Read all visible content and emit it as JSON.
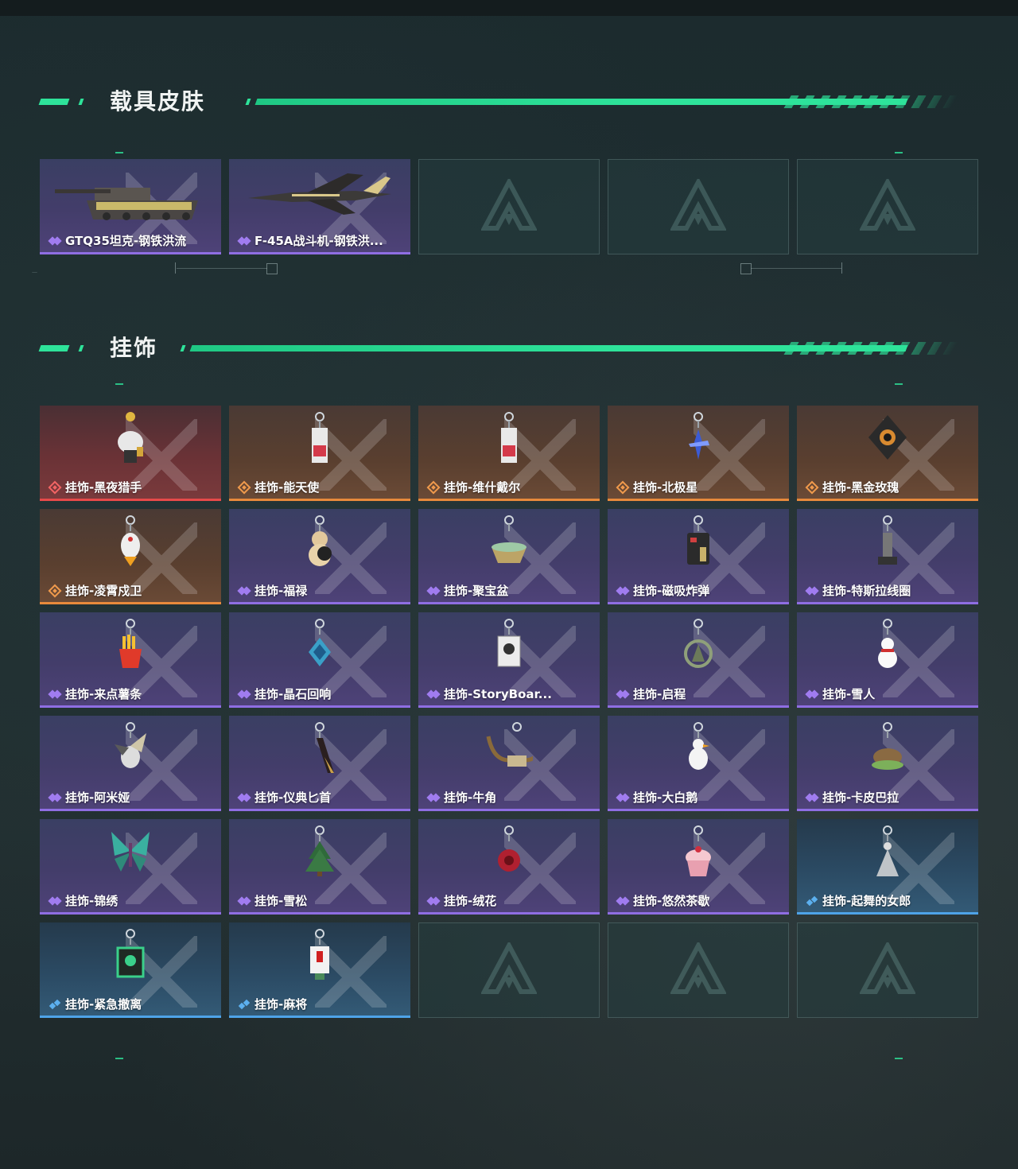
{
  "sections": {
    "vehicle_skins": {
      "title": "载具皮肤",
      "items": [
        {
          "label": "GTQ35坦克-钢铁洪流",
          "rarity": "purple",
          "icon": "tank-icon"
        },
        {
          "label": "F-45A战斗机-钢铁洪...",
          "rarity": "purple",
          "icon": "fighter-jet-icon"
        }
      ]
    },
    "charms": {
      "title": "挂饰",
      "items": [
        {
          "label": "挂饰-黑夜猎手",
          "rarity": "red",
          "icon": "mech-charm-icon"
        },
        {
          "label": "挂饰-能天使",
          "rarity": "orange",
          "icon": "card-charm-icon"
        },
        {
          "label": "挂饰-维什戴尔",
          "rarity": "orange",
          "icon": "card-charm-icon"
        },
        {
          "label": "挂饰-北极星",
          "rarity": "orange",
          "icon": "star-charm-icon"
        },
        {
          "label": "挂饰-黑金玫瑰",
          "rarity": "orange",
          "icon": "rose-emblem-icon"
        },
        {
          "label": "挂饰-凌霄戍卫",
          "rarity": "orange",
          "icon": "bird-charm-icon"
        },
        {
          "label": "挂饰-福禄",
          "rarity": "purple",
          "icon": "gourd-charm-icon"
        },
        {
          "label": "挂饰-聚宝盆",
          "rarity": "purple",
          "icon": "treasure-bowl-icon"
        },
        {
          "label": "挂饰-磁吸炸弹",
          "rarity": "purple",
          "icon": "bomb-charm-icon"
        },
        {
          "label": "挂饰-特斯拉线圈",
          "rarity": "purple",
          "icon": "tesla-coil-icon"
        },
        {
          "label": "挂饰-来点薯条",
          "rarity": "purple",
          "icon": "fries-charm-icon"
        },
        {
          "label": "挂饰-晶石回响",
          "rarity": "purple",
          "icon": "crystal-charm-icon"
        },
        {
          "label": "挂饰-StoryBoar...",
          "rarity": "purple",
          "icon": "photo-card-icon"
        },
        {
          "label": "挂饰-启程",
          "rarity": "purple",
          "icon": "compass-charm-icon"
        },
        {
          "label": "挂饰-雪人",
          "rarity": "purple",
          "icon": "snowman-charm-icon"
        },
        {
          "label": "挂饰-阿米娅",
          "rarity": "purple",
          "icon": "bunny-charm-icon"
        },
        {
          "label": "挂饰-仪典匕首",
          "rarity": "purple",
          "icon": "dagger-charm-icon"
        },
        {
          "label": "挂饰-牛角",
          "rarity": "purple",
          "icon": "horns-charm-icon"
        },
        {
          "label": "挂饰-大白鹅",
          "rarity": "purple",
          "icon": "goose-charm-icon"
        },
        {
          "label": "挂饰-卡皮巴拉",
          "rarity": "purple",
          "icon": "capybara-charm-icon"
        },
        {
          "label": "挂饰-锦绣",
          "rarity": "purple",
          "icon": "butterfly-charm-icon"
        },
        {
          "label": "挂饰-雪松",
          "rarity": "purple",
          "icon": "pine-tree-charm-icon"
        },
        {
          "label": "挂饰-绒花",
          "rarity": "purple",
          "icon": "velvet-flower-icon"
        },
        {
          "label": "挂饰-悠然茶歇",
          "rarity": "purple",
          "icon": "cupcake-charm-icon"
        },
        {
          "label": "挂饰-起舞的女郎",
          "rarity": "blue",
          "icon": "dancer-charm-icon"
        },
        {
          "label": "挂饰-紧急撤离",
          "rarity": "blue",
          "icon": "exit-sign-charm-icon"
        },
        {
          "label": "挂饰-麻将",
          "rarity": "blue",
          "icon": "mahjong-charm-icon"
        }
      ]
    }
  },
  "colors": {
    "accent": "#2ee39a",
    "purple": "#8f6ee3",
    "orange": "#e88a3c",
    "red": "#e74a4a",
    "blue": "#4ea3e8"
  }
}
